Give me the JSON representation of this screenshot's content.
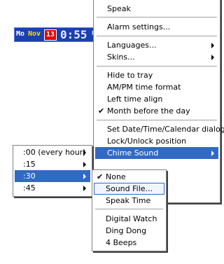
{
  "clock": {
    "day": "Mo",
    "month": "Nov",
    "date": "13",
    "time": "0:55",
    "ampm": "PM"
  },
  "main_menu": {
    "items": [
      {
        "label": "Speak"
      },
      {
        "label": "Alarm settings..."
      },
      {
        "label": "Languages..."
      },
      {
        "label": "Skins..."
      },
      {
        "label": "Hide to tray"
      },
      {
        "label": "AM/PM time format"
      },
      {
        "label": "Left time align"
      },
      {
        "label": "Month before the day",
        "checked": true
      },
      {
        "label": "Set Date/Time/Calendar dialog"
      },
      {
        "label": "Lock/Unlock position"
      },
      {
        "label": "Chime Sound",
        "highlighted": true
      }
    ],
    "check_glyph": "✔"
  },
  "chime_interval_menu": {
    "items": [
      {
        "label": ":00 (every hour)"
      },
      {
        "label": ":15"
      },
      {
        "label": ":30",
        "highlighted": true
      },
      {
        "label": ":45"
      }
    ]
  },
  "chime_sound_menu": {
    "items": [
      {
        "label": "None",
        "checked": true
      },
      {
        "label": "Sound File...",
        "focused": true
      },
      {
        "label": "Speak Time"
      },
      {
        "label": "Digital Watch"
      },
      {
        "label": "Ding Dong"
      },
      {
        "label": "4 Beeps"
      }
    ],
    "check_glyph": "✔"
  },
  "colors": {
    "highlight": "#316ac5",
    "clock_bg": "#1a3fb0",
    "date_badge": "#e00000"
  }
}
